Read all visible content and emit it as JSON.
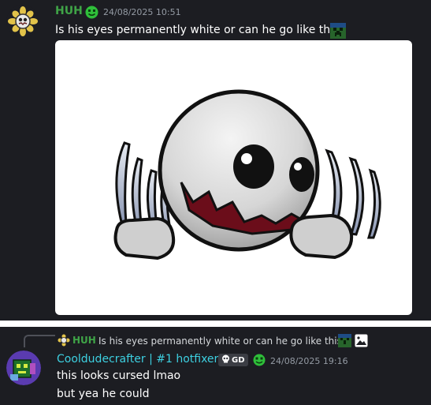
{
  "message1": {
    "username": "HUH",
    "timestamp": "24/08/2025 10:51",
    "text": "Is his eyes permanently white or can he go like this?",
    "name_color": "#3fa447"
  },
  "reply_preview": {
    "username": "HUH",
    "text": "Is his eyes permanently white or can he go like this?"
  },
  "message2": {
    "username": "Cooldudecrafter | #1 hotfixer",
    "clan_tag": "GD",
    "timestamp": "24/08/2025 19:16",
    "lines": [
      "this looks cursed lmao",
      "but yea he could"
    ],
    "name_color": "#3dd0e1"
  },
  "icons": {
    "avatar1": "sunflower-avatar-icon",
    "badge": "green-smiley-badge-icon",
    "inline_emoji": "green-creeper-emoji-icon",
    "reply_attachment": "image-icon",
    "clan_icon": "skull-icon"
  }
}
